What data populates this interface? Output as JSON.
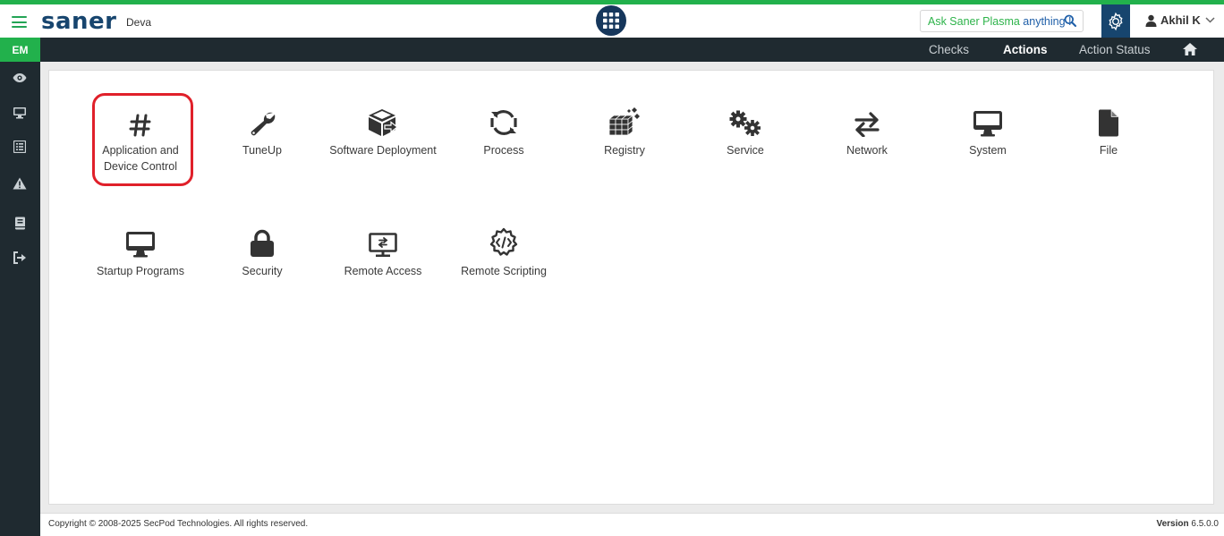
{
  "app": {
    "logo": "saner",
    "tenant": "Deva",
    "ask_prefix": "Ask Saner Plasma ",
    "ask_suffix": "anything !",
    "user_name": "Akhil K",
    "accent_green": "#22b14c",
    "brand_navy": "#17456e",
    "dark_bar": "#1f2a30"
  },
  "sidebar": {
    "badge": "EM",
    "items": [
      "eye-icon",
      "monitor-icon",
      "list-icon",
      "warning-icon",
      "book-icon",
      "logout-icon"
    ]
  },
  "nav": {
    "items": [
      {
        "label": "Checks",
        "active": false
      },
      {
        "label": "Actions",
        "active": true
      },
      {
        "label": "Action Status",
        "active": false
      }
    ],
    "home_icon": "home-icon"
  },
  "actions": {
    "row1": [
      {
        "label": "Application and Device Control",
        "icon": "hash-icon",
        "highlighted": true
      },
      {
        "label": "TuneUp",
        "icon": "wrench-icon"
      },
      {
        "label": "Software Deployment",
        "icon": "box-arrow-icon"
      },
      {
        "label": "Process",
        "icon": "sync-icon"
      },
      {
        "label": "Registry",
        "icon": "cubes-icon"
      },
      {
        "label": "Service",
        "icon": "cogs-icon"
      },
      {
        "label": "Network",
        "icon": "exchange-icon"
      },
      {
        "label": "System",
        "icon": "desktop-icon"
      },
      {
        "label": "File",
        "icon": "file-icon"
      }
    ],
    "row2": [
      {
        "label": "Startup Programs",
        "icon": "desktop-icon"
      },
      {
        "label": "Security",
        "icon": "lock-icon"
      },
      {
        "label": "Remote Access",
        "icon": "remote-desktop-icon"
      },
      {
        "label": "Remote Scripting",
        "icon": "code-gear-icon"
      }
    ]
  },
  "footer": {
    "copyright": "Copyright © 2008-2025 SecPod Technologies. All rights reserved.",
    "version_label": "Version",
    "version_value": "6.5.0.0"
  }
}
